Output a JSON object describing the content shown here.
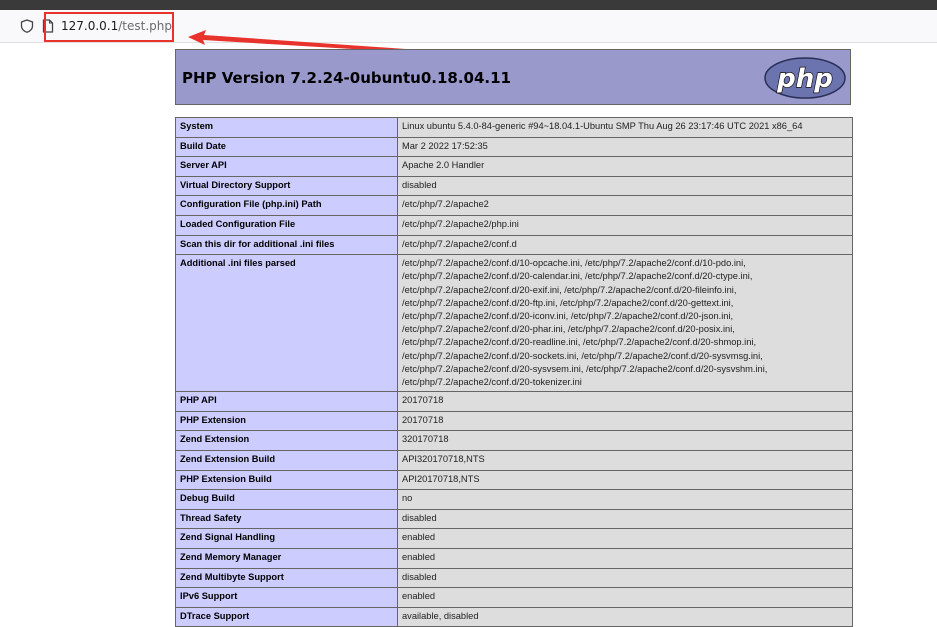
{
  "browser": {
    "url_host": "127.0.0.1",
    "url_path": "/test.php"
  },
  "page": {
    "title": "PHP Version 7.2.24-0ubuntu0.18.04.11",
    "logo_text": "php"
  },
  "rows": [
    {
      "label": "System",
      "value": "Linux ubuntu 5.4.0-84-generic #94~18.04.1-Ubuntu SMP Thu Aug 26 23:17:46 UTC 2021 x86_64"
    },
    {
      "label": "Build Date",
      "value": "Mar 2 2022 17:52:35"
    },
    {
      "label": "Server API",
      "value": "Apache 2.0 Handler"
    },
    {
      "label": "Virtual Directory Support",
      "value": "disabled"
    },
    {
      "label": "Configuration File (php.ini) Path",
      "value": "/etc/php/7.2/apache2"
    },
    {
      "label": "Loaded Configuration File",
      "value": "/etc/php/7.2/apache2/php.ini"
    },
    {
      "label": "Scan this dir for additional .ini files",
      "value": "/etc/php/7.2/apache2/conf.d"
    },
    {
      "label": "Additional .ini files parsed",
      "value": "/etc/php/7.2/apache2/conf.d/10-opcache.ini, /etc/php/7.2/apache2/conf.d/10-pdo.ini, /etc/php/7.2/apache2/conf.d/20-calendar.ini, /etc/php/7.2/apache2/conf.d/20-ctype.ini, /etc/php/7.2/apache2/conf.d/20-exif.ini, /etc/php/7.2/apache2/conf.d/20-fileinfo.ini, /etc/php/7.2/apache2/conf.d/20-ftp.ini, /etc/php/7.2/apache2/conf.d/20-gettext.ini, /etc/php/7.2/apache2/conf.d/20-iconv.ini, /etc/php/7.2/apache2/conf.d/20-json.ini, /etc/php/7.2/apache2/conf.d/20-phar.ini, /etc/php/7.2/apache2/conf.d/20-posix.ini, /etc/php/7.2/apache2/conf.d/20-readline.ini, /etc/php/7.2/apache2/conf.d/20-shmop.ini, /etc/php/7.2/apache2/conf.d/20-sockets.ini, /etc/php/7.2/apache2/conf.d/20-sysvmsg.ini, /etc/php/7.2/apache2/conf.d/20-sysvsem.ini, /etc/php/7.2/apache2/conf.d/20-sysvshm.ini, /etc/php/7.2/apache2/conf.d/20-tokenizer.ini"
    },
    {
      "label": "PHP API",
      "value": "20170718"
    },
    {
      "label": "PHP Extension",
      "value": "20170718"
    },
    {
      "label": "Zend Extension",
      "value": "320170718"
    },
    {
      "label": "Zend Extension Build",
      "value": "API320170718,NTS"
    },
    {
      "label": "PHP Extension Build",
      "value": "API20170718,NTS"
    },
    {
      "label": "Debug Build",
      "value": "no"
    },
    {
      "label": "Thread Safety",
      "value": "disabled"
    },
    {
      "label": "Zend Signal Handling",
      "value": "enabled"
    },
    {
      "label": "Zend Memory Manager",
      "value": "enabled"
    },
    {
      "label": "Zend Multibyte Support",
      "value": "disabled"
    },
    {
      "label": "IPv6 Support",
      "value": "enabled"
    },
    {
      "label": "DTrace Support",
      "value": "available, disabled"
    }
  ],
  "colors": {
    "header_bg": "#9999cc",
    "label_bg": "#ccccff",
    "value_bg": "#dddddd",
    "annotation_red": "#e8322c"
  }
}
